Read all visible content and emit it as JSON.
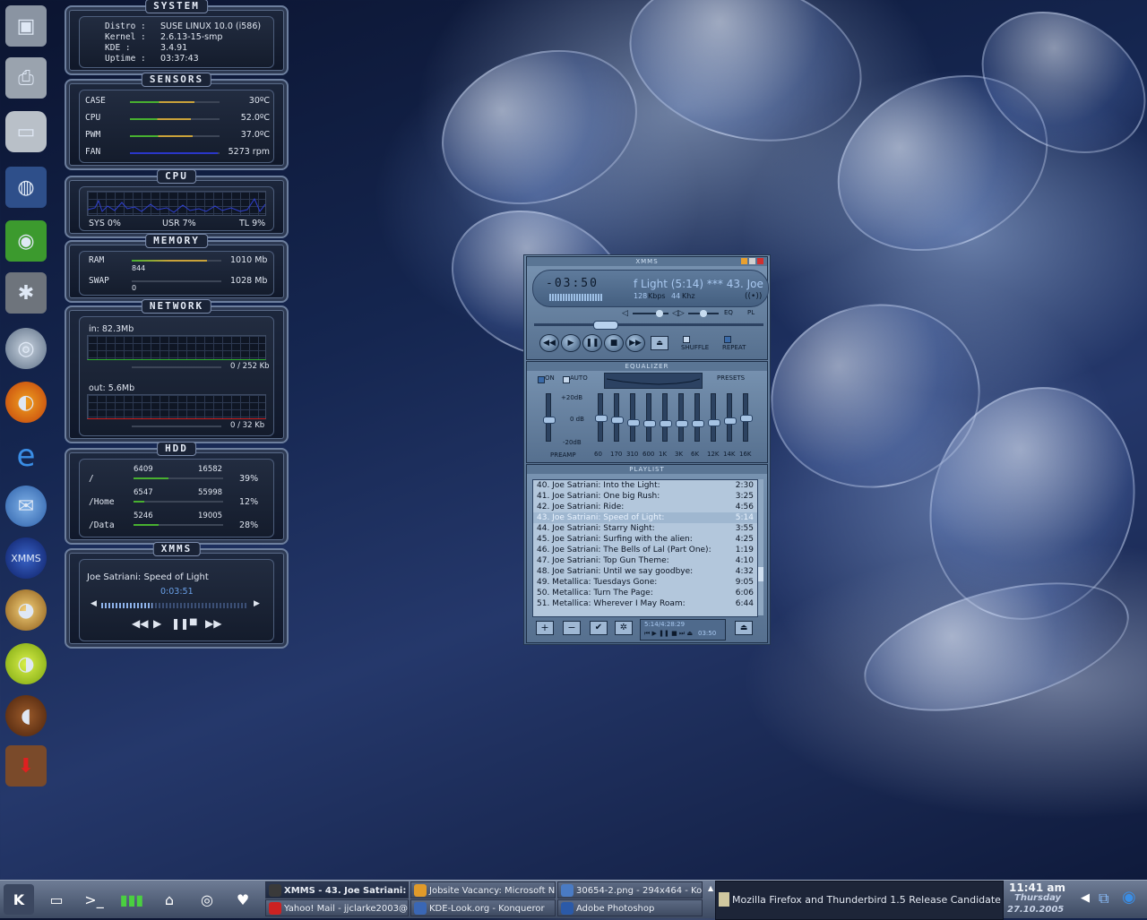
{
  "system": {
    "title": "SYSTEM",
    "rows": [
      {
        "label": "Distro :",
        "value": "SUSE LINUX 10.0 (i586)"
      },
      {
        "label": "Kernel :",
        "value": "2.6.13-15-smp"
      },
      {
        "label": "KDE :",
        "value": "3.4.91"
      },
      {
        "label": "Uptime :",
        "value": "03:37:43"
      }
    ]
  },
  "sensors": {
    "title": "SENSORS",
    "rows": [
      {
        "label": "CASE",
        "value": "30ºC",
        "level": 0.72,
        "color": "#c9a23a"
      },
      {
        "label": "CPU",
        "value": "52.0ºC",
        "level": 0.68,
        "color": "#c9a23a"
      },
      {
        "label": "PWM",
        "value": "37.0ºC",
        "level": 0.7,
        "color": "#c9a23a"
      },
      {
        "label": "FAN",
        "value": "5273 rpm",
        "level": 0.98,
        "color": "#2a36c9"
      }
    ]
  },
  "cpu": {
    "title": "CPU",
    "sys": "SYS 0%",
    "usr": "USR 7%",
    "tl": "TL 9%"
  },
  "memory": {
    "title": "MEMORY",
    "ram_label": "RAM",
    "ram_used": "844",
    "ram_total": "1010 Mb",
    "ram_level": 0.84,
    "swap_label": "SWAP",
    "swap_used": "0",
    "swap_total": "1028 Mb",
    "swap_level": 0.0
  },
  "network": {
    "title": "NETWORK",
    "in_label": "in: 82.3Mb",
    "in_rate": "0 / 252 Kb",
    "out_label": "out: 5.6Mb",
    "out_rate": "0 / 32 Kb"
  },
  "hdd": {
    "title": "HDD",
    "rows": [
      {
        "mount": "/",
        "used": "6409",
        "total": "16582",
        "pct": "39%",
        "level": 0.39
      },
      {
        "mount": "/Home",
        "used": "6547",
        "total": "55998",
        "pct": "12%",
        "level": 0.12
      },
      {
        "mount": "/Data",
        "used": "5246",
        "total": "19005",
        "pct": "28%",
        "level": 0.28
      }
    ]
  },
  "xmms_widget": {
    "title": "XMMS",
    "song": "Joe Satriani: Speed of Light",
    "time": "0:03:51",
    "progress": 0.35
  },
  "player": {
    "title": "XMMS",
    "time": "-03:50",
    "scroll": "f Light (5:14)  *** 43. Joe",
    "kbps": "128",
    "kbps_unit": "Kbps",
    "khz": "44",
    "khz_unit": "Khz",
    "eq_toggle": "EQ",
    "pl_toggle": "PL",
    "shuffle": "SHUFFLE",
    "repeat": "REPEAT"
  },
  "equalizer": {
    "title": "EQUALIZER",
    "on": "ON",
    "auto": "AUTO",
    "presets": "PRESETS",
    "db_top": "+20dB",
    "db_mid": "0 dB",
    "db_bot": "-20dB",
    "preamp": "PREAMP",
    "bands": [
      "60",
      "170",
      "310",
      "600",
      "1K",
      "3K",
      "6K",
      "12K",
      "14K",
      "16K"
    ],
    "levels": [
      0.5,
      0.55,
      0.6,
      0.62,
      0.64,
      0.64,
      0.62,
      0.6,
      0.56,
      0.5
    ]
  },
  "playlist": {
    "title": "PLAYLIST",
    "selected": 3,
    "items": [
      {
        "name": "40. Joe Satriani: Into the Light:",
        "len": "2:30"
      },
      {
        "name": "41. Joe Satriani: One big Rush:",
        "len": "3:25"
      },
      {
        "name": "42. Joe Satriani: Ride:",
        "len": "4:56"
      },
      {
        "name": "43. Joe Satriani: Speed of Light:",
        "len": "5:14"
      },
      {
        "name": "44. Joe Satriani: Starry Night:",
        "len": "3:55"
      },
      {
        "name": "45. Joe Satriani: Surfing with the alien:",
        "len": "4:25"
      },
      {
        "name": "46. Joe Satriani: The Bells of Lal (Part One):",
        "len": "1:19"
      },
      {
        "name": "47. Joe Satriani: Top Gun Theme:",
        "len": "4:10"
      },
      {
        "name": "48. Joe Satriani: Until we say goodbye:",
        "len": "4:32"
      },
      {
        "name": "49. Metallica: Tuesdays Gone:",
        "len": "9:05"
      },
      {
        "name": "50. Metallica: Turn The Page:",
        "len": "6:06"
      },
      {
        "name": "51. Metallica: Wherever I May Roam:",
        "len": "6:44"
      }
    ],
    "status": "5:14/4:28:29",
    "mini_time": "03:50"
  },
  "taskbar": {
    "tasks": [
      {
        "label": "XMMS - 43. Joe Satriani: Sp",
        "active": true,
        "color": "#3a3a3a"
      },
      {
        "label": "Jobsite Vacancy: Microsoft Ne",
        "active": false,
        "color": "#e09a2a"
      },
      {
        "label": "30654-2.png - 294x464 - Konq",
        "active": false,
        "color": "#4a7bc4"
      },
      {
        "label": "Yahoo! Mail - jjclarke2003@",
        "active": false,
        "color": "#c22"
      },
      {
        "label": "KDE-Look.org - Konqueror",
        "active": false,
        "color": "#3a67b5"
      },
      {
        "label": "Adobe Photoshop",
        "active": false,
        "color": "#2b5aa8"
      }
    ],
    "news": "Mozilla Firefox and Thunderbird 1.5 Release Candidate",
    "clock_time": "11:41 am",
    "clock_day": "Thursday",
    "clock_date": "27.10.2005"
  },
  "icons": {
    "dock": [
      "monitor-icon",
      "printer-icon",
      "trash-icon",
      "network-monitor-icon",
      "suse-monitor-icon",
      "kde-monitor-icon",
      "globe-icon",
      "firefox-icon",
      "internet-explorer-icon",
      "thunderbird-icon",
      "xmms-icon",
      "eye-icon",
      "lime-icon",
      "coffee-bean-icon",
      "download-icon"
    ]
  }
}
